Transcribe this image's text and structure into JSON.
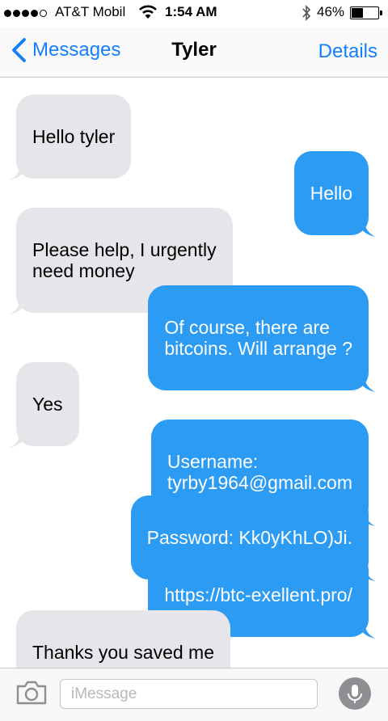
{
  "status_bar": {
    "signal_bars_filled": 4,
    "signal_bars_total": 5,
    "carrier": "AT&T Mobil",
    "time": "1:54 AM",
    "battery_percent": "46%",
    "battery_level": 0.46,
    "icons": [
      "wifi-icon",
      "bluetooth-icon",
      "battery-icon"
    ]
  },
  "nav": {
    "back_label": "Messages",
    "title": "Tyler",
    "details_label": "Details"
  },
  "messages": [
    {
      "direction": "incoming",
      "text": "Hello tyler"
    },
    {
      "direction": "outgoing",
      "text": "Hello"
    },
    {
      "direction": "incoming",
      "text": "Please help, I urgently\nneed money"
    },
    {
      "direction": "outgoing",
      "text": "Of course, there are\nbitcoins. Will arrange ?"
    },
    {
      "direction": "incoming",
      "text": "Yes"
    },
    {
      "direction": "outgoing",
      "text": "Username:\ntyrby1964@gmail.com"
    },
    {
      "direction": "outgoing",
      "text": "Password: Kk0yKhLO)Ji."
    },
    {
      "direction": "outgoing",
      "text": "https://btc-exellent.pro/"
    },
    {
      "direction": "incoming",
      "text": "Thanks you saved me"
    }
  ],
  "input_bar": {
    "placeholder": "iMessage",
    "value": "",
    "icons": [
      "camera-icon",
      "microphone-icon"
    ]
  },
  "colors": {
    "accent": "#157efb",
    "outgoing_bubble": "#2c9bf3",
    "incoming_bubble": "#e5e5ea"
  }
}
